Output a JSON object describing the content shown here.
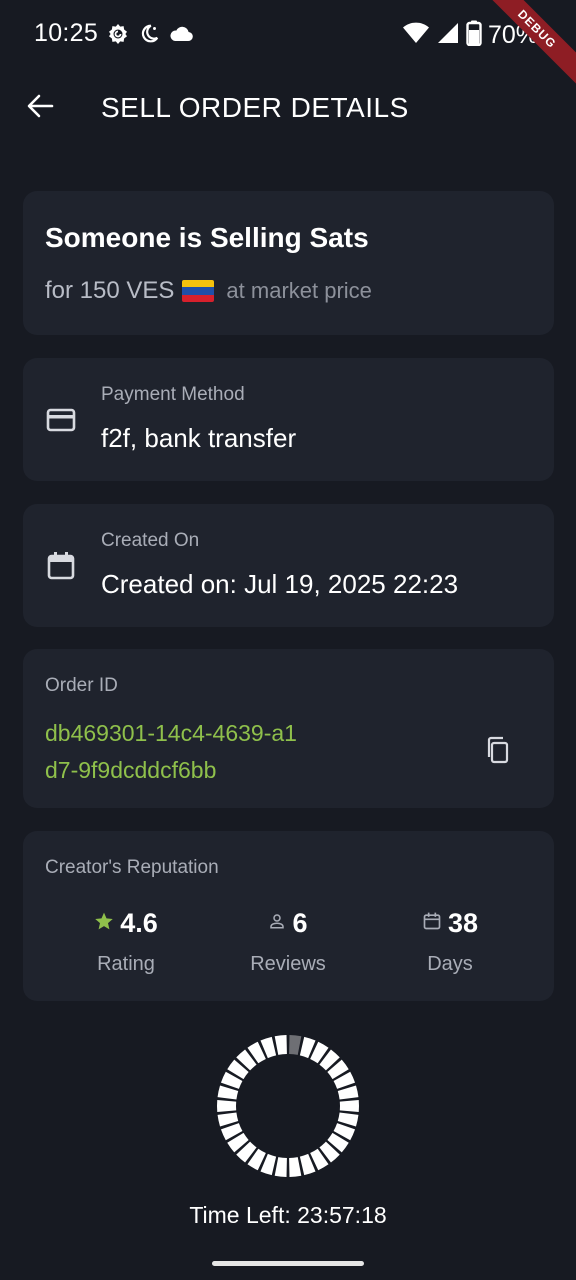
{
  "status_bar": {
    "time": "10:25",
    "battery": "70%",
    "debug_label": "DEBUG",
    "left_icons": [
      "app-notification-icon",
      "do-not-disturb-moon-icon",
      "cloud-icon"
    ],
    "right_icons": [
      "wifi-icon",
      "cellular-signal-icon",
      "battery-icon"
    ]
  },
  "app_bar": {
    "title": "SELL ORDER DETAILS",
    "back_icon": "arrow-back-icon"
  },
  "summary": {
    "title": "Someone is Selling Sats",
    "amount_text": "for 150 VES",
    "flag": "venezuela-flag",
    "price_text": "at market price"
  },
  "payment_method": {
    "icon": "credit-card-icon",
    "label": "Payment Method",
    "value": "f2f, bank transfer"
  },
  "created": {
    "icon": "calendar-icon",
    "label": "Created On",
    "value": "Created on: Jul 19, 2025 22:23"
  },
  "order": {
    "label": "Order ID",
    "id": "db469301-14c4-4639-a1d7-9f9dcddcf6bb",
    "copy_icon": "copy-icon"
  },
  "reputation": {
    "label": "Creator's Reputation",
    "stats": [
      {
        "icon": "star-icon",
        "value": "4.6",
        "caption": "Rating"
      },
      {
        "icon": "person-icon",
        "value": "6",
        "caption": "Reviews"
      },
      {
        "icon": "calendar-icon",
        "value": "38",
        "caption": "Days"
      }
    ]
  },
  "timer": {
    "text": "Time Left: 23:57:18",
    "segments_total": 30,
    "segments_elapsed": 1
  },
  "colors": {
    "background": "#171a22",
    "card": "#1f232d",
    "accent_green": "#8fc04b",
    "debug_red": "#8e1d24"
  }
}
